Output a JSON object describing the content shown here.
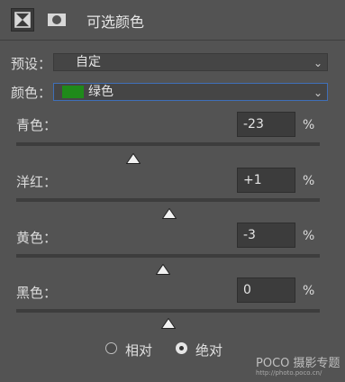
{
  "header": {
    "title": "可选颜色",
    "icons": [
      "adjustment-icon",
      "mask-icon"
    ]
  },
  "preset": {
    "label": "预设：",
    "value": "自定"
  },
  "colors": {
    "label": "颜色：",
    "value": "绿色",
    "swatch_color": "#1f8a1a"
  },
  "sliders": [
    {
      "label": "青色：",
      "value": "-23",
      "unit": "%",
      "position": -23
    },
    {
      "label": "洋红：",
      "value": "+1",
      "unit": "%",
      "position": 1
    },
    {
      "label": "黄色：",
      "value": "-3",
      "unit": "%",
      "position": -3
    },
    {
      "label": "黑色：",
      "value": "0",
      "unit": "%",
      "position": 0
    }
  ],
  "method": {
    "relative_label": "相对",
    "absolute_label": "绝对",
    "selected": "absolute"
  },
  "watermark": {
    "brand": "POCO 摄影专题",
    "url": "http://photo.poco.cn/"
  },
  "theme": {
    "panel_bg": "#535353",
    "field_bg": "#3c3c3c",
    "accent_border": "#3f6fb8"
  }
}
